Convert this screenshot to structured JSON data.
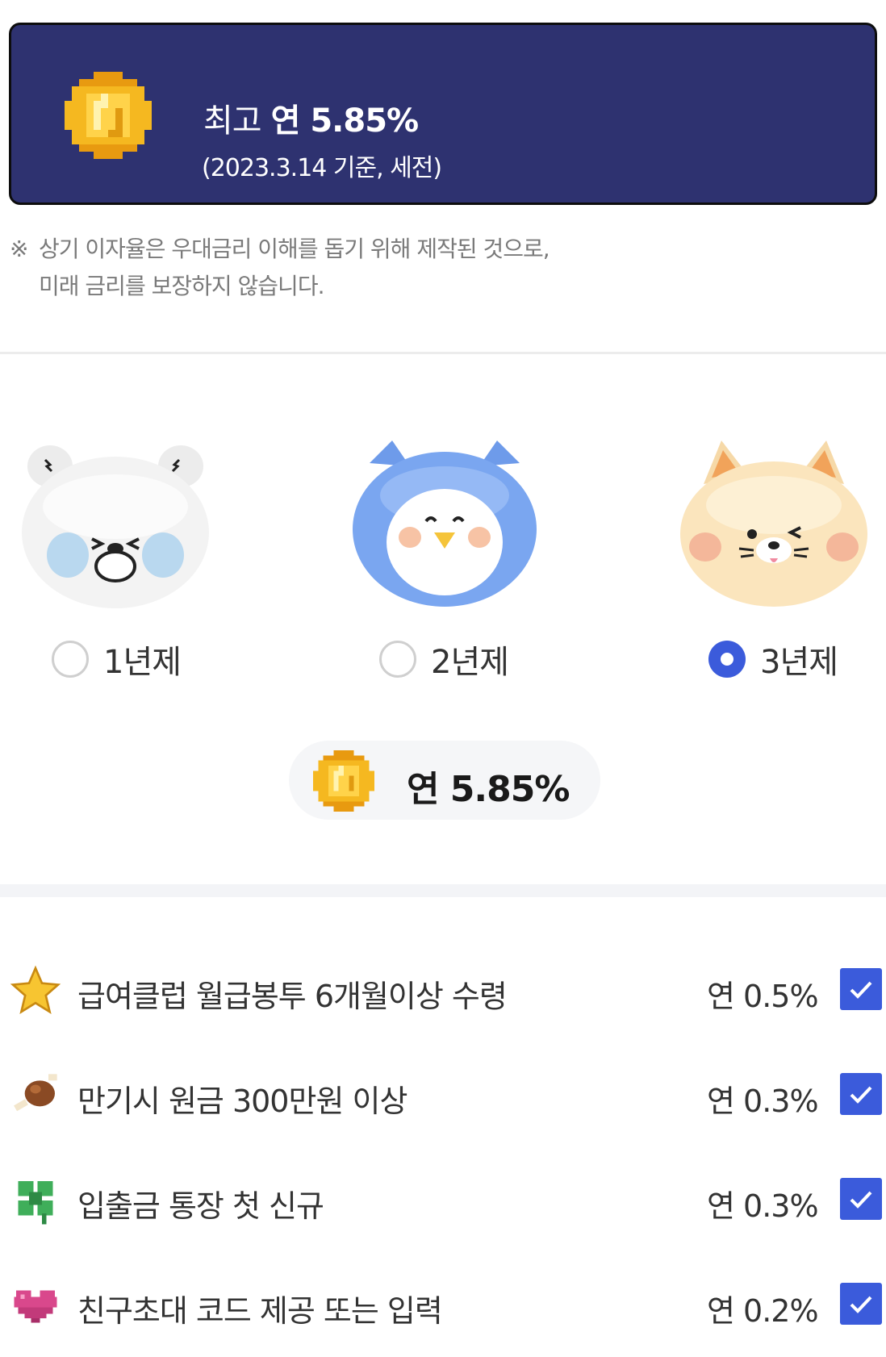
{
  "banner": {
    "prefix": "최고",
    "rate": "연 5.85%",
    "basis": "(2023.3.14 기준, 세전)",
    "coin_icon": "pixel-coin-icon"
  },
  "note": {
    "mark": "※",
    "line1": "상기 이자율은 우대금리 이해를 돕기 위해 제작된 것으로,",
    "line2": "미래 금리를 보장하지 않습니다."
  },
  "period_options": [
    {
      "label": "1년제",
      "character": "polar-bear",
      "selected": false
    },
    {
      "label": "2년제",
      "character": "blue-bird",
      "selected": false
    },
    {
      "label": "3년제",
      "character": "cat",
      "selected": true
    }
  ],
  "selected_rate": "연 5.85%",
  "benefits": [
    {
      "icon": "star-icon",
      "label": "급여클럽 월급봉투 6개월이상 수령",
      "rate": "연 0.5%",
      "checked": true
    },
    {
      "icon": "meat-icon",
      "label": "만기시 원금 300만원 이상",
      "rate": "연 0.3%",
      "checked": true
    },
    {
      "icon": "clover-icon",
      "label": "입출금 통장 첫 신규",
      "rate": "연 0.3%",
      "checked": true
    },
    {
      "icon": "heart-icon",
      "label": "친구초대 코드 제공 또는 입력",
      "rate": "연 0.2%",
      "checked": true
    }
  ],
  "colors": {
    "banner_bg": "#2e3270",
    "accent": "#3b5bdb",
    "coin": "#f5b820"
  }
}
